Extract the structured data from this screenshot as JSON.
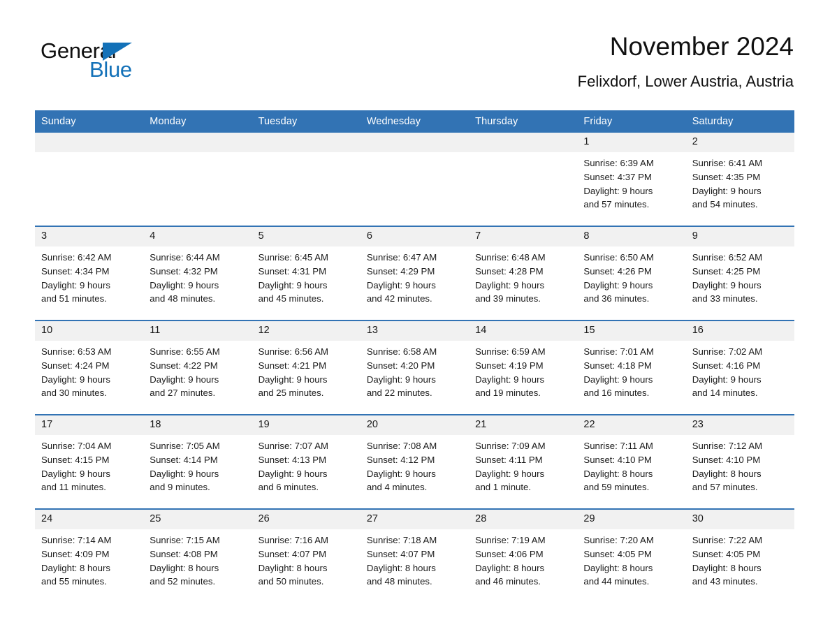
{
  "brand": {
    "name_part1": "General",
    "name_part2": "Blue",
    "logo_icon": "triangle-flag-icon",
    "accent_color": "#1371b8"
  },
  "header": {
    "month_title": "November 2024",
    "location": "Felixdorf, Lower Austria, Austria"
  },
  "theme": {
    "header_blue": "#3273b4",
    "daynum_band": "#f1f1f1",
    "text": "#1a1a1a"
  },
  "calendar": {
    "weekday_headers": [
      "Sunday",
      "Monday",
      "Tuesday",
      "Wednesday",
      "Thursday",
      "Friday",
      "Saturday"
    ],
    "weeks": [
      [
        {
          "day": "",
          "lines": []
        },
        {
          "day": "",
          "lines": []
        },
        {
          "day": "",
          "lines": []
        },
        {
          "day": "",
          "lines": []
        },
        {
          "day": "",
          "lines": []
        },
        {
          "day": "1",
          "lines": [
            "Sunrise: 6:39 AM",
            "Sunset: 4:37 PM",
            "Daylight: 9 hours",
            "and 57 minutes."
          ]
        },
        {
          "day": "2",
          "lines": [
            "Sunrise: 6:41 AM",
            "Sunset: 4:35 PM",
            "Daylight: 9 hours",
            "and 54 minutes."
          ]
        }
      ],
      [
        {
          "day": "3",
          "lines": [
            "Sunrise: 6:42 AM",
            "Sunset: 4:34 PM",
            "Daylight: 9 hours",
            "and 51 minutes."
          ]
        },
        {
          "day": "4",
          "lines": [
            "Sunrise: 6:44 AM",
            "Sunset: 4:32 PM",
            "Daylight: 9 hours",
            "and 48 minutes."
          ]
        },
        {
          "day": "5",
          "lines": [
            "Sunrise: 6:45 AM",
            "Sunset: 4:31 PM",
            "Daylight: 9 hours",
            "and 45 minutes."
          ]
        },
        {
          "day": "6",
          "lines": [
            "Sunrise: 6:47 AM",
            "Sunset: 4:29 PM",
            "Daylight: 9 hours",
            "and 42 minutes."
          ]
        },
        {
          "day": "7",
          "lines": [
            "Sunrise: 6:48 AM",
            "Sunset: 4:28 PM",
            "Daylight: 9 hours",
            "and 39 minutes."
          ]
        },
        {
          "day": "8",
          "lines": [
            "Sunrise: 6:50 AM",
            "Sunset: 4:26 PM",
            "Daylight: 9 hours",
            "and 36 minutes."
          ]
        },
        {
          "day": "9",
          "lines": [
            "Sunrise: 6:52 AM",
            "Sunset: 4:25 PM",
            "Daylight: 9 hours",
            "and 33 minutes."
          ]
        }
      ],
      [
        {
          "day": "10",
          "lines": [
            "Sunrise: 6:53 AM",
            "Sunset: 4:24 PM",
            "Daylight: 9 hours",
            "and 30 minutes."
          ]
        },
        {
          "day": "11",
          "lines": [
            "Sunrise: 6:55 AM",
            "Sunset: 4:22 PM",
            "Daylight: 9 hours",
            "and 27 minutes."
          ]
        },
        {
          "day": "12",
          "lines": [
            "Sunrise: 6:56 AM",
            "Sunset: 4:21 PM",
            "Daylight: 9 hours",
            "and 25 minutes."
          ]
        },
        {
          "day": "13",
          "lines": [
            "Sunrise: 6:58 AM",
            "Sunset: 4:20 PM",
            "Daylight: 9 hours",
            "and 22 minutes."
          ]
        },
        {
          "day": "14",
          "lines": [
            "Sunrise: 6:59 AM",
            "Sunset: 4:19 PM",
            "Daylight: 9 hours",
            "and 19 minutes."
          ]
        },
        {
          "day": "15",
          "lines": [
            "Sunrise: 7:01 AM",
            "Sunset: 4:18 PM",
            "Daylight: 9 hours",
            "and 16 minutes."
          ]
        },
        {
          "day": "16",
          "lines": [
            "Sunrise: 7:02 AM",
            "Sunset: 4:16 PM",
            "Daylight: 9 hours",
            "and 14 minutes."
          ]
        }
      ],
      [
        {
          "day": "17",
          "lines": [
            "Sunrise: 7:04 AM",
            "Sunset: 4:15 PM",
            "Daylight: 9 hours",
            "and 11 minutes."
          ]
        },
        {
          "day": "18",
          "lines": [
            "Sunrise: 7:05 AM",
            "Sunset: 4:14 PM",
            "Daylight: 9 hours",
            "and 9 minutes."
          ]
        },
        {
          "day": "19",
          "lines": [
            "Sunrise: 7:07 AM",
            "Sunset: 4:13 PM",
            "Daylight: 9 hours",
            "and 6 minutes."
          ]
        },
        {
          "day": "20",
          "lines": [
            "Sunrise: 7:08 AM",
            "Sunset: 4:12 PM",
            "Daylight: 9 hours",
            "and 4 minutes."
          ]
        },
        {
          "day": "21",
          "lines": [
            "Sunrise: 7:09 AM",
            "Sunset: 4:11 PM",
            "Daylight: 9 hours",
            "and 1 minute."
          ]
        },
        {
          "day": "22",
          "lines": [
            "Sunrise: 7:11 AM",
            "Sunset: 4:10 PM",
            "Daylight: 8 hours",
            "and 59 minutes."
          ]
        },
        {
          "day": "23",
          "lines": [
            "Sunrise: 7:12 AM",
            "Sunset: 4:10 PM",
            "Daylight: 8 hours",
            "and 57 minutes."
          ]
        }
      ],
      [
        {
          "day": "24",
          "lines": [
            "Sunrise: 7:14 AM",
            "Sunset: 4:09 PM",
            "Daylight: 8 hours",
            "and 55 minutes."
          ]
        },
        {
          "day": "25",
          "lines": [
            "Sunrise: 7:15 AM",
            "Sunset: 4:08 PM",
            "Daylight: 8 hours",
            "and 52 minutes."
          ]
        },
        {
          "day": "26",
          "lines": [
            "Sunrise: 7:16 AM",
            "Sunset: 4:07 PM",
            "Daylight: 8 hours",
            "and 50 minutes."
          ]
        },
        {
          "day": "27",
          "lines": [
            "Sunrise: 7:18 AM",
            "Sunset: 4:07 PM",
            "Daylight: 8 hours",
            "and 48 minutes."
          ]
        },
        {
          "day": "28",
          "lines": [
            "Sunrise: 7:19 AM",
            "Sunset: 4:06 PM",
            "Daylight: 8 hours",
            "and 46 minutes."
          ]
        },
        {
          "day": "29",
          "lines": [
            "Sunrise: 7:20 AM",
            "Sunset: 4:05 PM",
            "Daylight: 8 hours",
            "and 44 minutes."
          ]
        },
        {
          "day": "30",
          "lines": [
            "Sunrise: 7:22 AM",
            "Sunset: 4:05 PM",
            "Daylight: 8 hours",
            "and 43 minutes."
          ]
        }
      ]
    ]
  }
}
